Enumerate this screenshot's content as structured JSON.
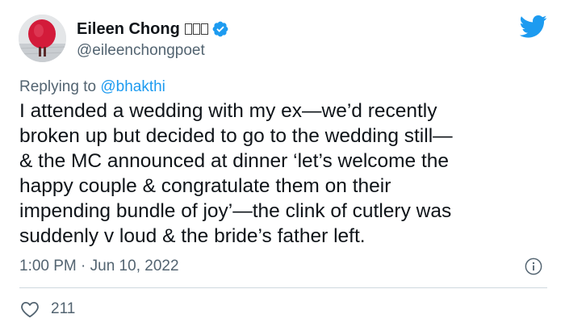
{
  "author": {
    "display_name": "Eileen Chong",
    "handle": "@eileenchongpoet",
    "verified": true
  },
  "reply": {
    "prefix": "Replying to ",
    "to_handle": "@bhakthi"
  },
  "tweet": {
    "lines": [
      "I attended a wedding with my ex—we’d recently",
      "broken up but decided to go to the wedding still—",
      "& the MC announced at dinner ‘let’s welcome the",
      "happy couple & congratulate them on their",
      "impending bundle of joy’—the clink of cutlery was",
      "suddenly v loud & the bride’s father left."
    ]
  },
  "meta": {
    "timestamp": "1:00 PM · Jun 10, 2022"
  },
  "engagement": {
    "likes": "211"
  },
  "icons": {
    "brand": "twitter-bird-icon",
    "verified": "verified-badge-icon",
    "info": "info-icon",
    "like": "heart-icon"
  },
  "colors": {
    "twitter_blue": "#1d9bf0",
    "secondary_text": "#536471",
    "primary_text": "#0f1419",
    "divider": "#cfd9de"
  }
}
